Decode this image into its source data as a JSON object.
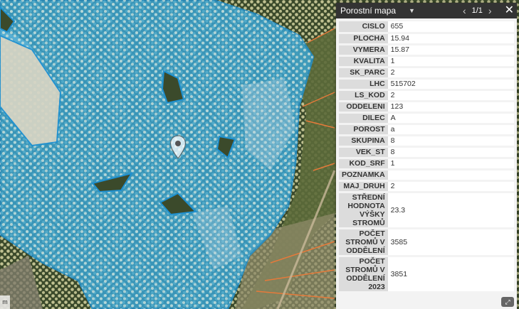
{
  "popup": {
    "title": "Porostní mapa",
    "page": "1/1",
    "attributes": [
      {
        "key": "CISLO",
        "value": "655"
      },
      {
        "key": "PLOCHA",
        "value": "15.94"
      },
      {
        "key": "VYMERA",
        "value": "15.87"
      },
      {
        "key": "KVALITA",
        "value": "1"
      },
      {
        "key": "SK_PARC",
        "value": "2"
      },
      {
        "key": "LHC",
        "value": "515702"
      },
      {
        "key": "LS_KOD",
        "value": "2"
      },
      {
        "key": "ODDELENI",
        "value": "123"
      },
      {
        "key": "DILEC",
        "value": "A"
      },
      {
        "key": "POROST",
        "value": "a"
      },
      {
        "key": "SKUPINA",
        "value": "8"
      },
      {
        "key": "VEK_ST",
        "value": "8"
      },
      {
        "key": "KOD_SRF",
        "value": "1"
      },
      {
        "key": "POZNAMKA",
        "value": ""
      },
      {
        "key": "MAJ_DRUH",
        "value": "2"
      },
      {
        "key": "STŘEDNÍ HODNOTA VÝŠKY STROMŮ",
        "value": "23.3"
      },
      {
        "key": "POČET STROMŮ V ODDĚLENÍ",
        "value": "3585"
      },
      {
        "key": "POČET STROMŮ V ODDĚLENÍ 2023",
        "value": "3851"
      }
    ]
  },
  "map": {
    "icons": {
      "marker": "map-pin-icon",
      "prev": "chevron-left-icon",
      "next": "chevron-right-icon",
      "close": "close-icon",
      "menu": "caret-down-icon",
      "expand": "zoom-to-icon"
    },
    "colors": {
      "selection_fill": "#3aa6d6",
      "selection_outline": "#1e90d0",
      "tree_dots": "#f4f0b8",
      "stand_outline": "#e67a3a"
    }
  }
}
